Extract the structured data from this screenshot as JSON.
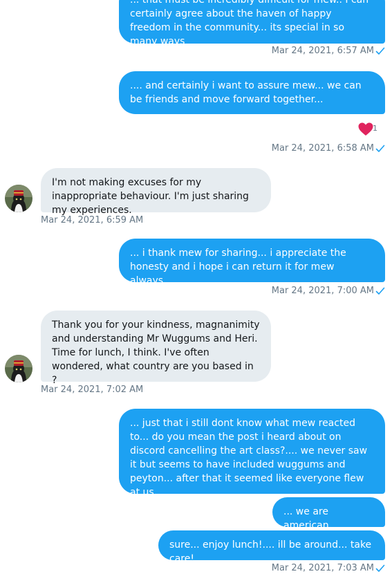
{
  "messages": [
    {
      "side": "out",
      "text": "... that must be incredibly difficult for mew.. I can certainly agree about the haven of happy freedom in the community... its special in so many ways",
      "time": "Mar 24, 2021, 6:57 AM"
    },
    {
      "side": "out",
      "text": ".... and certainly i want to assure mew... we can be friends and move forward together...",
      "time": "Mar 24, 2021, 6:58 AM",
      "reaction": {
        "icon": "heart-icon",
        "count": "1",
        "color": "#e0245e"
      }
    },
    {
      "side": "in",
      "text": "I'm not making excuses for my inappropriate behaviour. I'm just sharing my experiences.",
      "time": "Mar 24, 2021, 6:59 AM"
    },
    {
      "side": "out",
      "text": "... i thank mew for sharing... i appreciate the honesty and i hope i can return it for mew always...",
      "time": "Mar 24, 2021, 7:00 AM"
    },
    {
      "side": "in",
      "text": "Thank you for your kindness, magnanimity and understanding Mr Wuggums and Heri. Time for lunch, I think.   I've often wondered, what country are you based in ?",
      "time": "Mar 24, 2021, 7:02 AM"
    },
    {
      "side": "out",
      "text": "... just that i still dont know what mew reacted to... do you mean the post i heard about on discord cancelling the art class?.... we never saw it but seems to have included wuggums and peyton... after that it seemed like everyone flew at us..."
    },
    {
      "side": "out",
      "text": "... we are american..."
    },
    {
      "side": "out",
      "text": "sure... enjoy lunch!.... ill be around... take care!",
      "time": "Mar 24, 2021, 7:03 AM"
    }
  ],
  "colors": {
    "outgoing": "#1da1f2",
    "incoming": "#e6ecf0",
    "meta": "#657786",
    "check": "#1da1f2"
  }
}
